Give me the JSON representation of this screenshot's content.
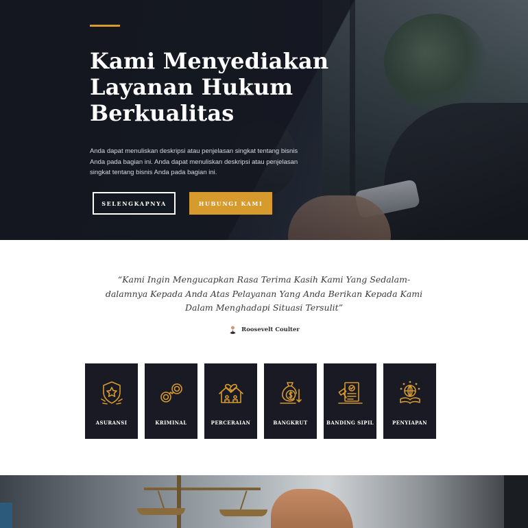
{
  "hero": {
    "title": "Kami Menyediakan Layanan Hukum Berkualitas",
    "description": "Anda dapat menuliskan deskripsi atau penjelasan singkat tentang bisnis Anda pada bagian ini. Anda dapat menuliskan deskripsi atau penjelasan singkat tentang bisnis Anda pada bagian ini.",
    "btn_more": "SELENGKAPNYA",
    "btn_contact": "HUBUNGI KAMI",
    "accent_color": "#d69a2d"
  },
  "testimonial": {
    "quote": "“Kami Ingin Mengucapkan Rasa Terima Kasih Kami Yang Sedalam-dalamnya Kepada Anda Atas Pelayanan Yang Anda Berikan Kepada Kami Dalam Menghadapi Situasi Tersulit”",
    "author": "Roosevelt Coulter"
  },
  "services": [
    {
      "label": "ASURANSI",
      "icon": "shield-star-icon"
    },
    {
      "label": "KRIMINAL",
      "icon": "handcuffs-icon"
    },
    {
      "label": "PERCERAIAN",
      "icon": "broken-home-heart-icon"
    },
    {
      "label": "BANGKRUT",
      "icon": "money-down-icon"
    },
    {
      "label": "BANDING SIPIL",
      "icon": "document-hammer-icon"
    },
    {
      "label": "PENYIAPAN",
      "icon": "globe-book-icon"
    }
  ]
}
